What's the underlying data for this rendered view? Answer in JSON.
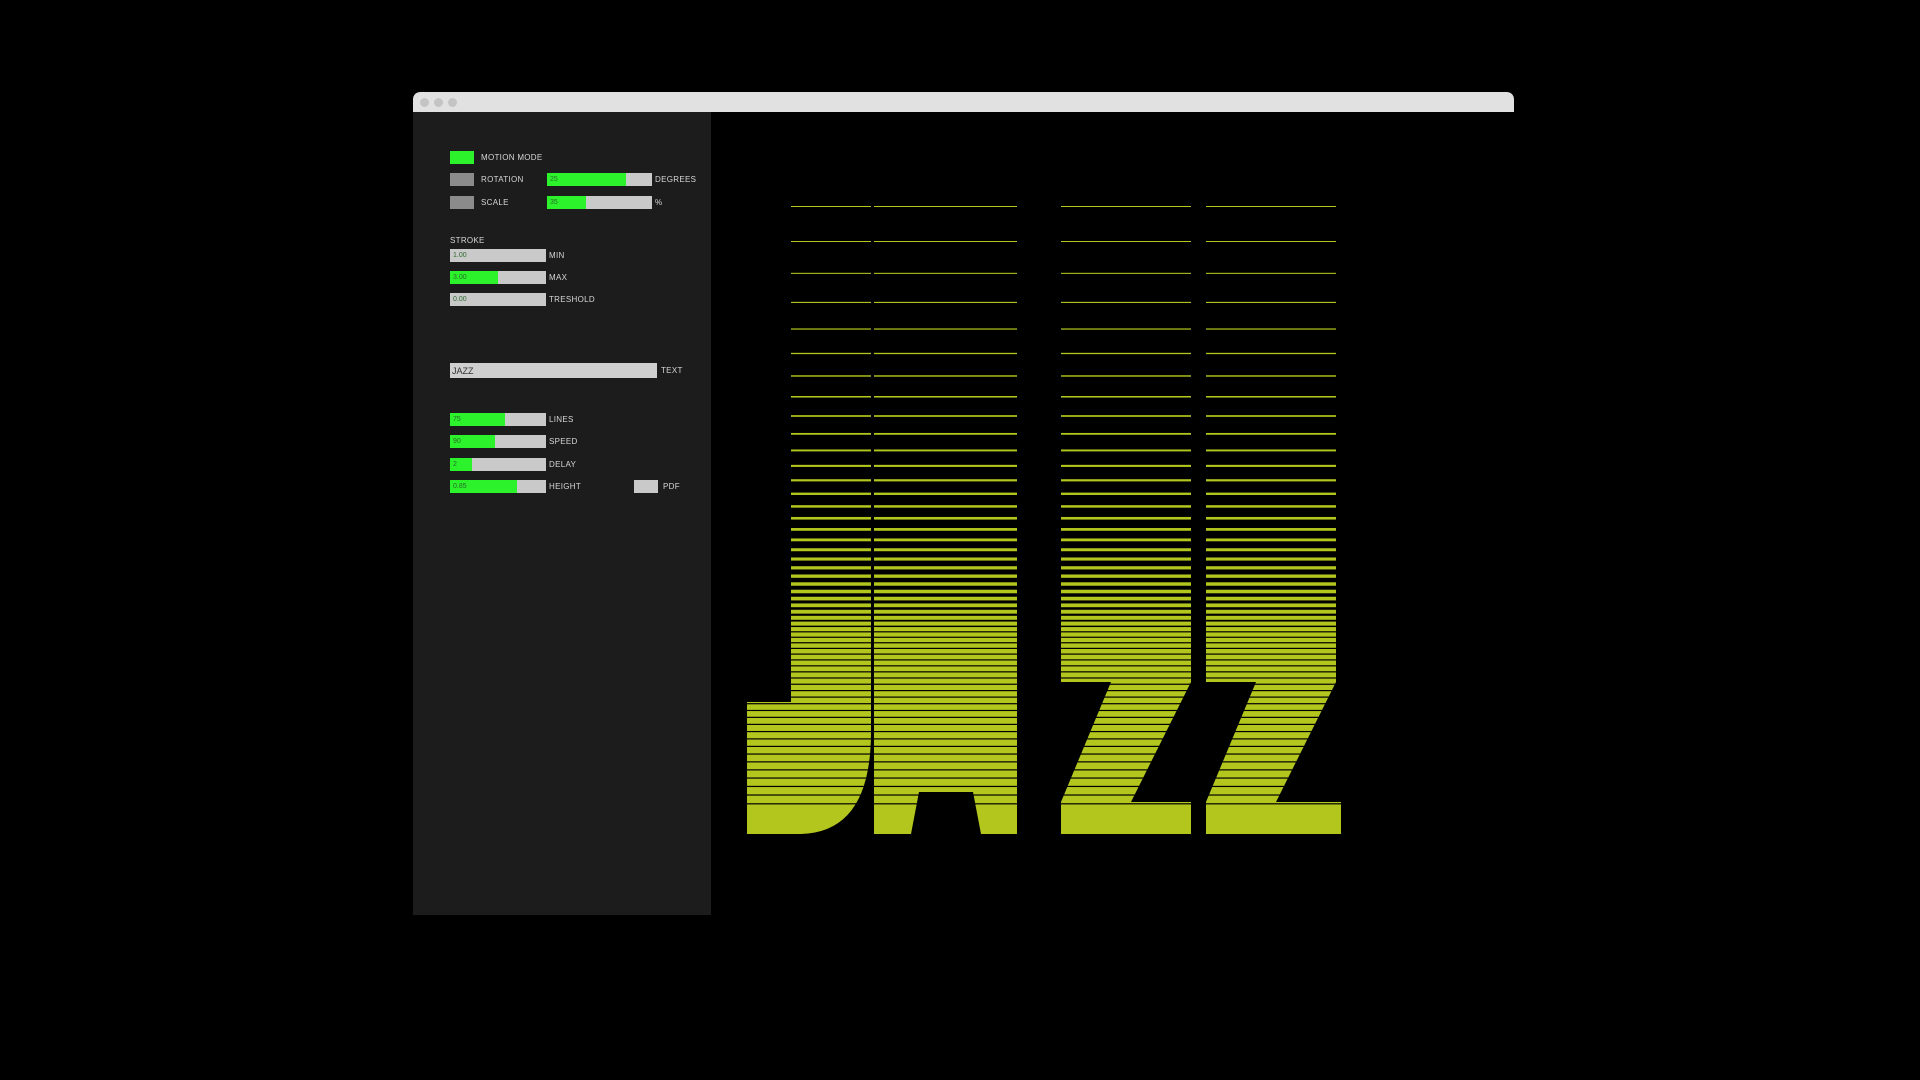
{
  "colors": {
    "accent_green": "#2bf22b",
    "art_yellow_green": "#b3c61d",
    "panel_bg": "#1c1c1c",
    "canvas_bg": "#000000",
    "titlebar_bg": "#e1e1e1"
  },
  "window": {
    "controls": [
      "close-dot",
      "minimize-dot",
      "maximize-dot"
    ]
  },
  "controls": {
    "motion_mode": {
      "label": "MOTION MODE",
      "on": true
    },
    "rotation": {
      "label": "ROTATION",
      "on": false,
      "value": "25",
      "level": 0.75,
      "unit": "DEGREES"
    },
    "scale": {
      "label": "SCALE",
      "on": false,
      "value": "35",
      "level": 0.37,
      "unit": "%"
    },
    "stroke": {
      "heading": "STROKE",
      "min": {
        "value": "1.00",
        "level": 0.0,
        "label": "MIN"
      },
      "max": {
        "value": "3.00",
        "level": 0.5,
        "label": "MAX"
      },
      "treshold": {
        "value": "0.00",
        "level": 0.0,
        "label": "TRESHOLD"
      }
    },
    "text": {
      "value": "JAZZ",
      "label": "TEXT"
    },
    "lines": {
      "value": "75",
      "level": 0.57,
      "label": "LINES"
    },
    "speed": {
      "value": "90",
      "level": 0.47,
      "label": "SPEED"
    },
    "delay": {
      "value": "2",
      "level": 0.23,
      "label": "DELAY"
    },
    "height": {
      "value": "0.85",
      "level": 0.7,
      "label": "HEIGHT"
    },
    "pdf": {
      "label": "PDF"
    }
  },
  "artwork": {
    "text": "JAZZ"
  }
}
